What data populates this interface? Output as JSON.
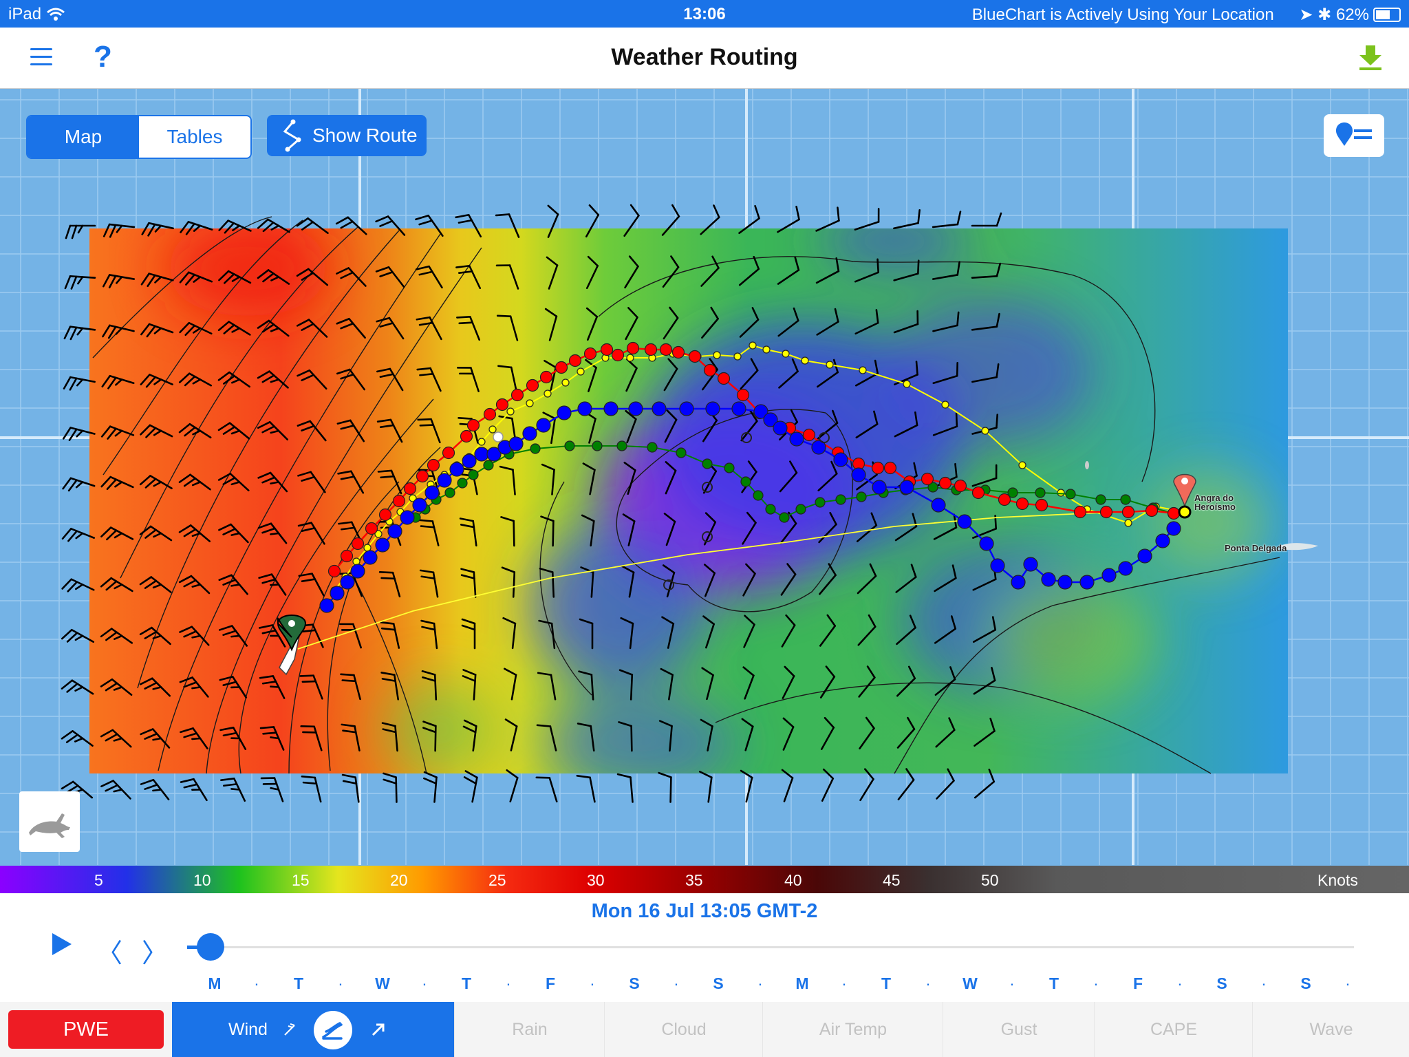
{
  "status_bar": {
    "device": "iPad",
    "time": "13:06",
    "location_text": "BlueChart is Actively Using Your Location",
    "battery": "62%"
  },
  "header": {
    "title": "Weather Routing",
    "menu_icon": "hamburger-menu-icon",
    "help_label": "?",
    "download_icon": "download-icon"
  },
  "map_controls": {
    "map_label": "Map",
    "tables_label": "Tables",
    "active_view": "Map",
    "show_route_label": "Show Route",
    "legend_icon": "map-pin-list-icon",
    "speed_icon": "rabbit-icon"
  },
  "places": {
    "angra": "Angra do Heroísmo",
    "ponta": "Ponta Delgada"
  },
  "legend": {
    "values": [
      "5",
      "10",
      "15",
      "20",
      "25",
      "30",
      "35",
      "40",
      "45",
      "50"
    ],
    "unit": "Knots"
  },
  "timeline": {
    "date": "Mon 16 Jul 13:05 GMT-2",
    "days": [
      "M",
      "T",
      "W",
      "T",
      "F",
      "S",
      "S",
      "M",
      "T",
      "W",
      "T",
      "F",
      "S",
      "S"
    ],
    "position": 0.02
  },
  "tabs": {
    "pwe": "PWE",
    "wind": "Wind",
    "rain": "Rain",
    "cloud": "Cloud",
    "air_temp": "Air Temp",
    "gust": "Gust",
    "cape": "CAPE",
    "wave": "Wave"
  },
  "colors": {
    "accent": "#1a73e8",
    "pwe_red": "#ee1c24",
    "download_green": "#7cc21d",
    "route_red": "#ff0000",
    "route_yellow": "#ffff00",
    "route_blue": "#0000ff",
    "route_green": "#008000"
  }
}
